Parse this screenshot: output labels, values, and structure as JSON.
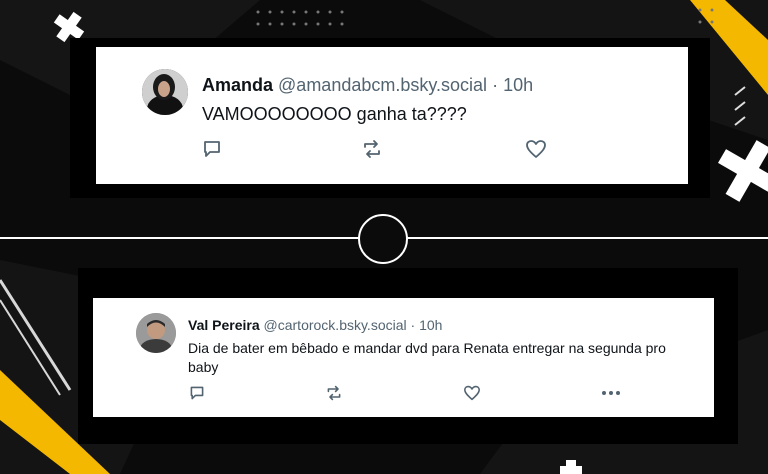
{
  "colors": {
    "accent_yellow": "#f5b800",
    "background": "#0b0b0b",
    "card": "#ffffff",
    "text": "#0f1419",
    "muted": "#536471"
  },
  "posts": [
    {
      "display_name": "Amanda",
      "handle": "@amandabcm.bsky.social",
      "separator": "·",
      "time": "10h",
      "text": "VAMOOOOOOOO ganha ta????",
      "actions": [
        "reply-icon",
        "repost-icon",
        "like-icon"
      ]
    },
    {
      "display_name": "Val Pereira",
      "handle": "@cartorock.bsky.social",
      "separator": "·",
      "time": "10h",
      "text": "Dia de bater em bêbado e mandar dvd para Renata entregar na segunda pro baby",
      "actions": [
        "reply-icon",
        "repost-icon",
        "like-icon",
        "more-icon"
      ]
    }
  ]
}
